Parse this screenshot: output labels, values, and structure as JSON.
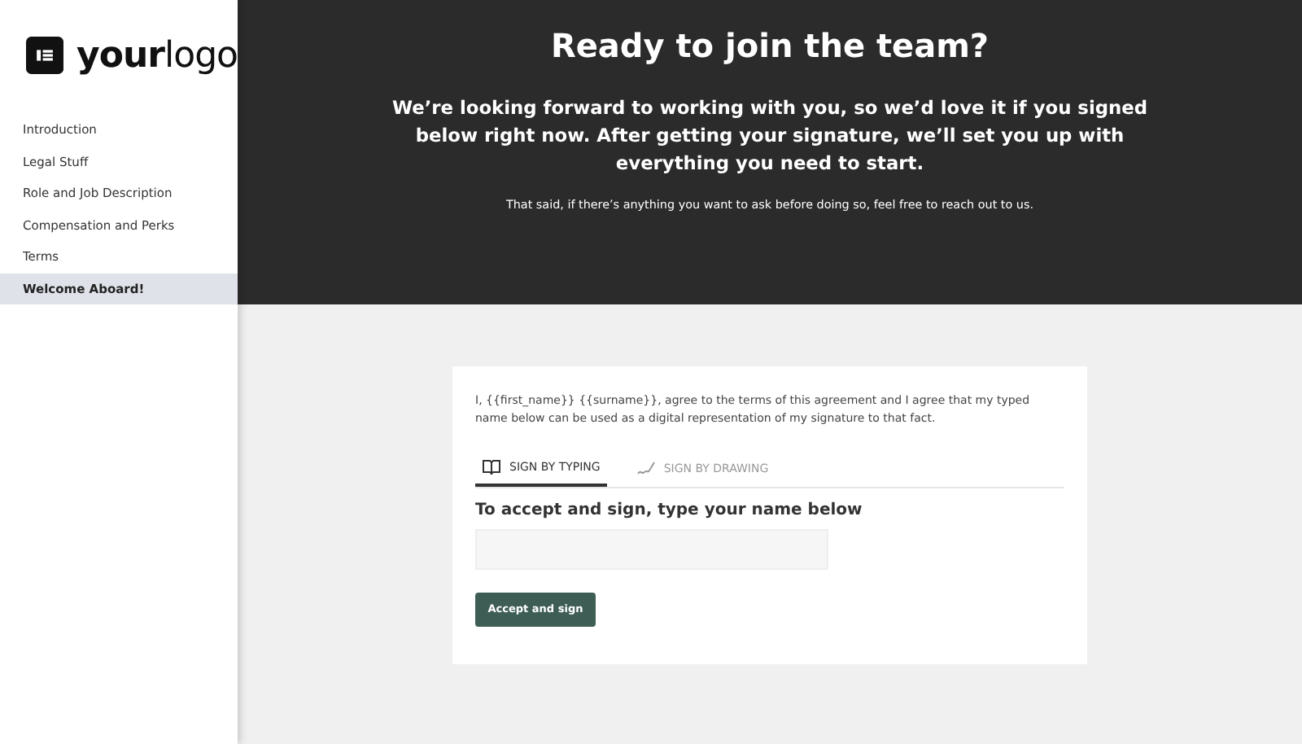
{
  "logo": {
    "text": "**your**logo"
  },
  "sidebar": {
    "items": [
      {
        "label": "Introduction",
        "selected": false
      },
      {
        "label": "Legal Stuff",
        "selected": false
      },
      {
        "label": "Role and Job Description",
        "selected": false
      },
      {
        "label": "Compensation and Perks",
        "selected": false
      },
      {
        "label": "Terms",
        "selected": false
      },
      {
        "label": "Welcome Aboard!",
        "selected": true
      }
    ]
  },
  "header": {
    "title": "Ready to join the team?",
    "lead": "We’re looking forward to working with you, so we’d love it if you signed below right now. After getting your signature, we’ll set you up with everything you need to start.",
    "note": "That said, if there’s anything you want to ask before doing so, feel free to reach out to us."
  },
  "sign_card": {
    "agreement": "I, {{first_name}} {{surname}}, agree to the terms of this agreement and I agree that my typed name below can be used as a digital representation of my signature to that fact.",
    "tabs": [
      {
        "label": "SIGN BY TYPING",
        "kind": "typing",
        "selected": true
      },
      {
        "label": "SIGN BY DRAWING",
        "kind": "drawing",
        "selected": false
      }
    ],
    "prompt": "To accept and sign, type your name below",
    "button": "Accept and sign"
  }
}
